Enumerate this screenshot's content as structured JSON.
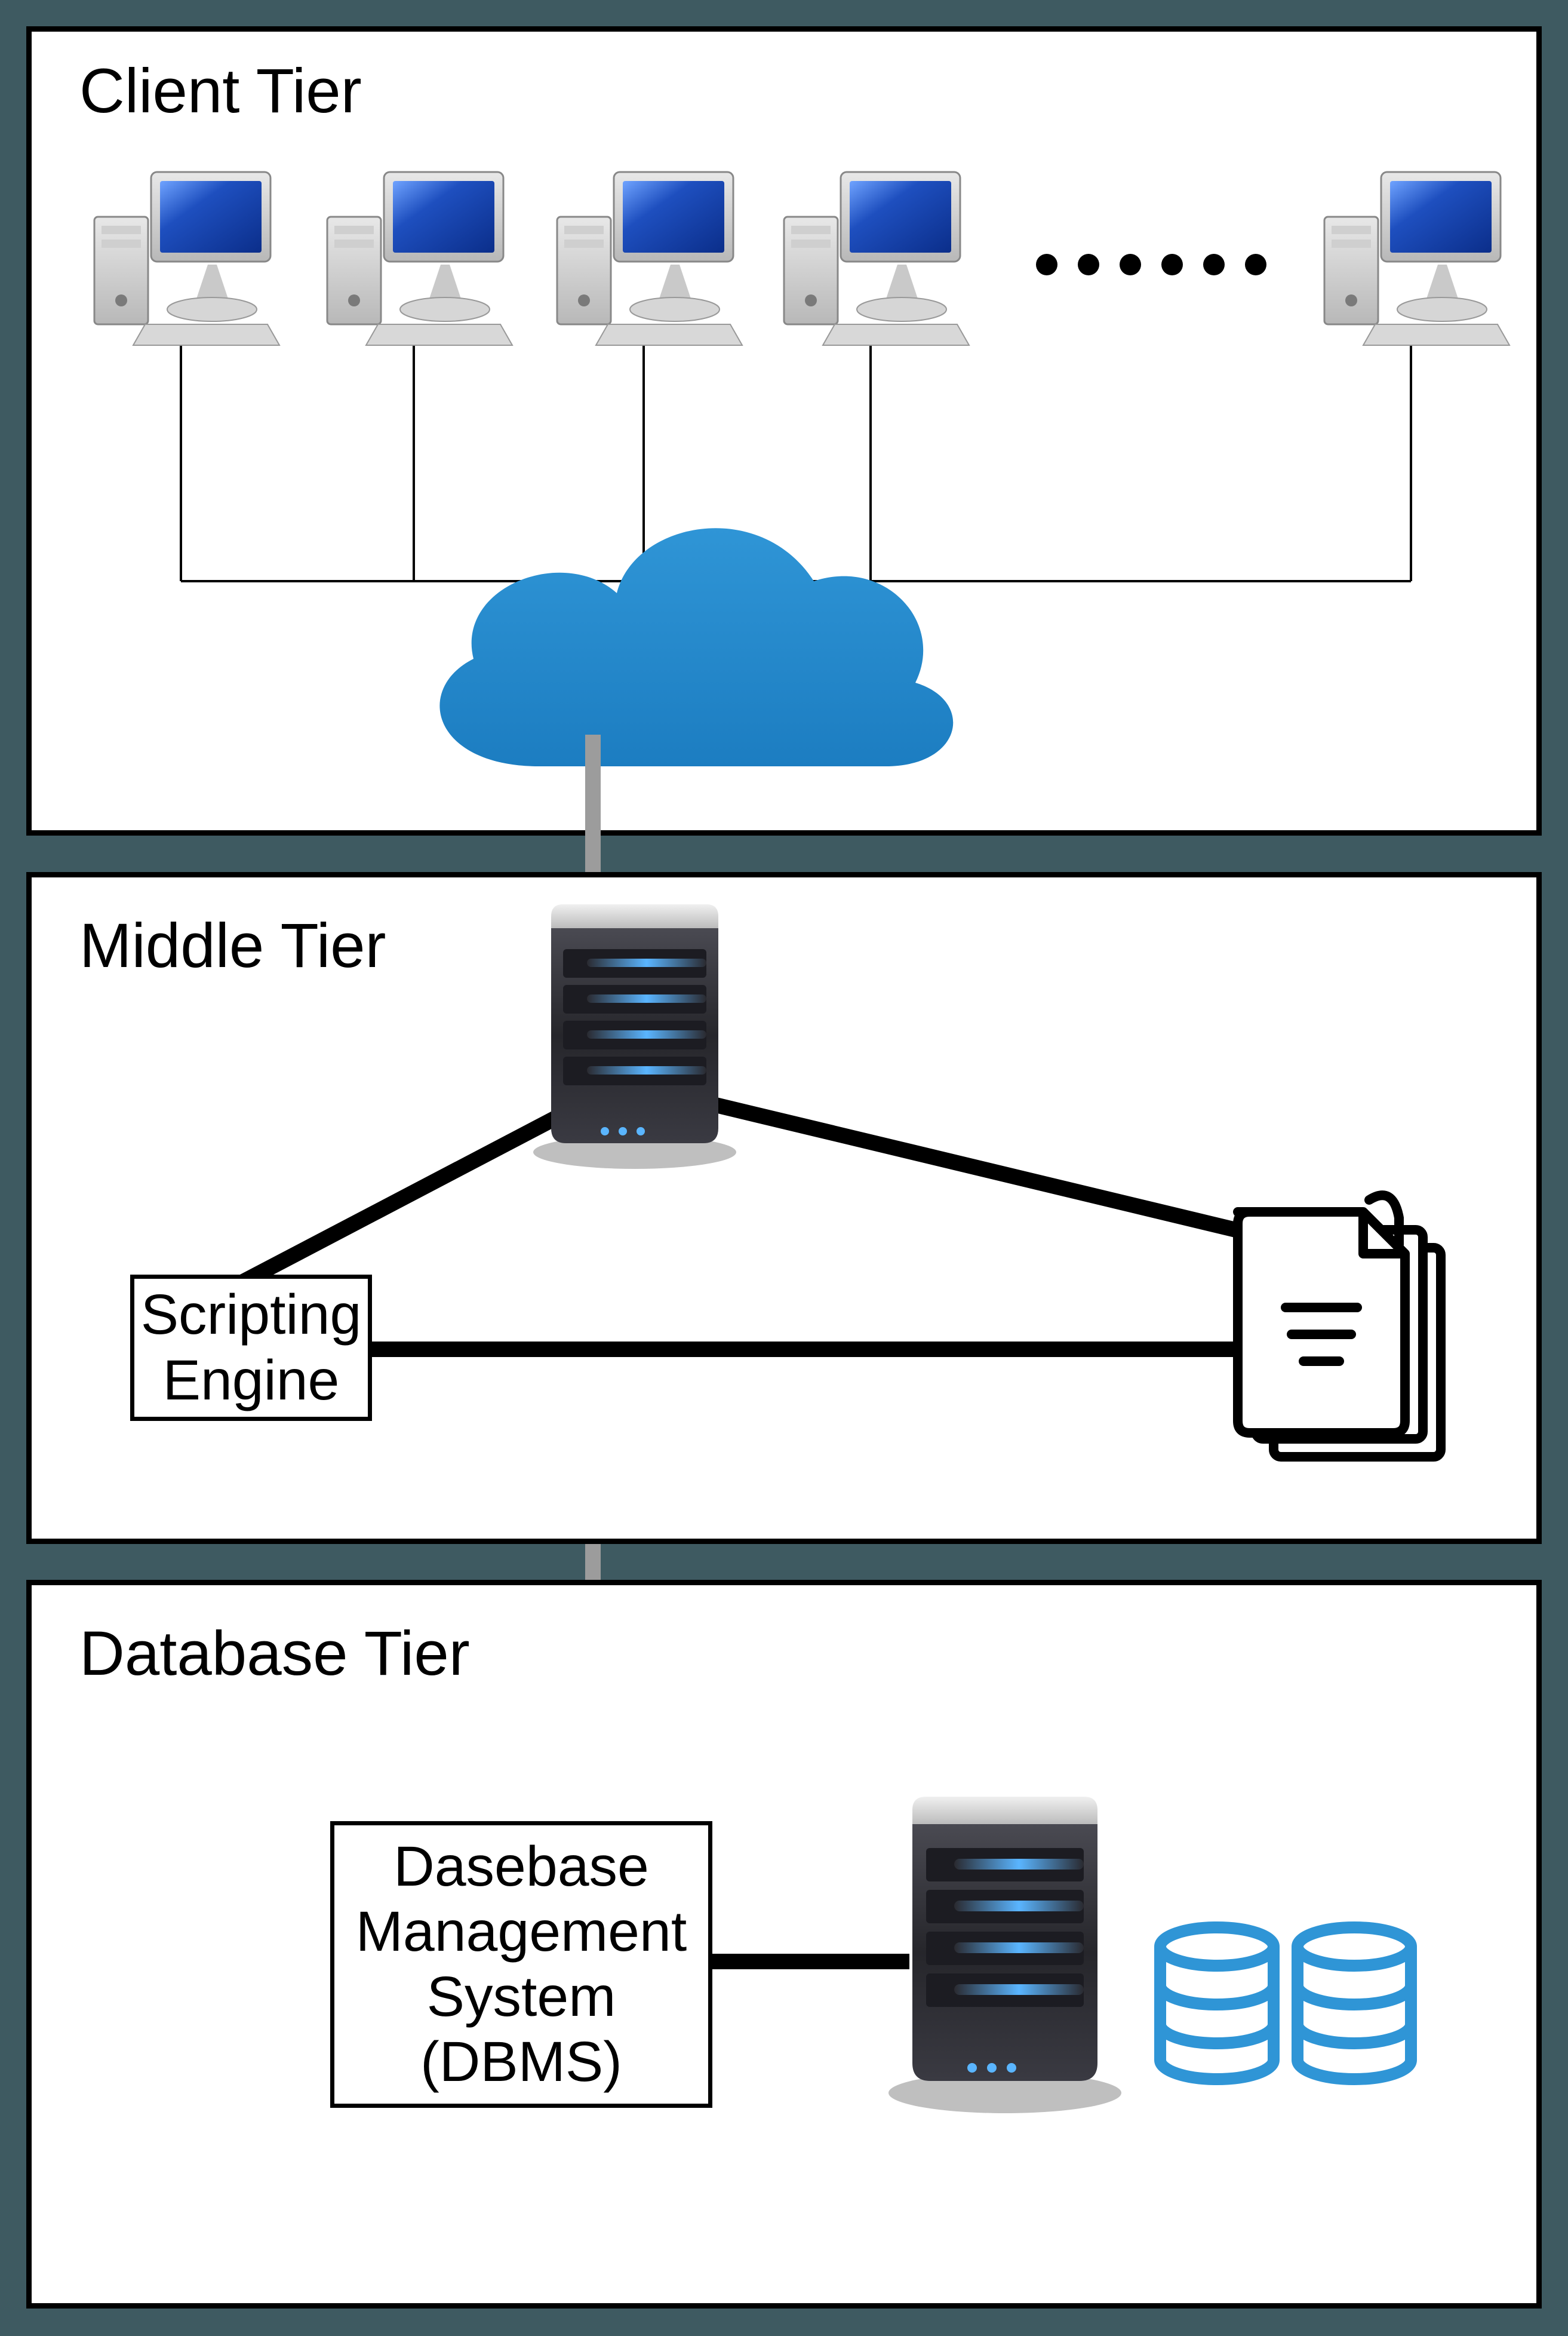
{
  "tiers": {
    "client": {
      "label": "Client Tier"
    },
    "middle": {
      "label": "Middle Tier"
    },
    "database": {
      "label": "Database Tier"
    }
  },
  "boxes": {
    "scripting": {
      "line1": "Scripting",
      "line2": "Engine"
    },
    "dbms": {
      "line1": "Dasebase",
      "line2": "Management",
      "line3": "System",
      "line4": "(DBMS)"
    }
  },
  "icons": {
    "workstation": "workstation-icon",
    "cloud": "cloud-icon",
    "server": "server-icon",
    "documents": "documents-icon",
    "database": "database-cylinder-icon",
    "ellipsis": "ellipsis-icon"
  },
  "colors": {
    "background": "#3e5a61",
    "panel": "#ffffff",
    "accent_blue": "#1c7dc1",
    "cylinder_blue": "#2f95d6",
    "server_dark": "#2a2a2e",
    "server_light": "#55555c",
    "monitor_screen": "#1e4fbf"
  }
}
